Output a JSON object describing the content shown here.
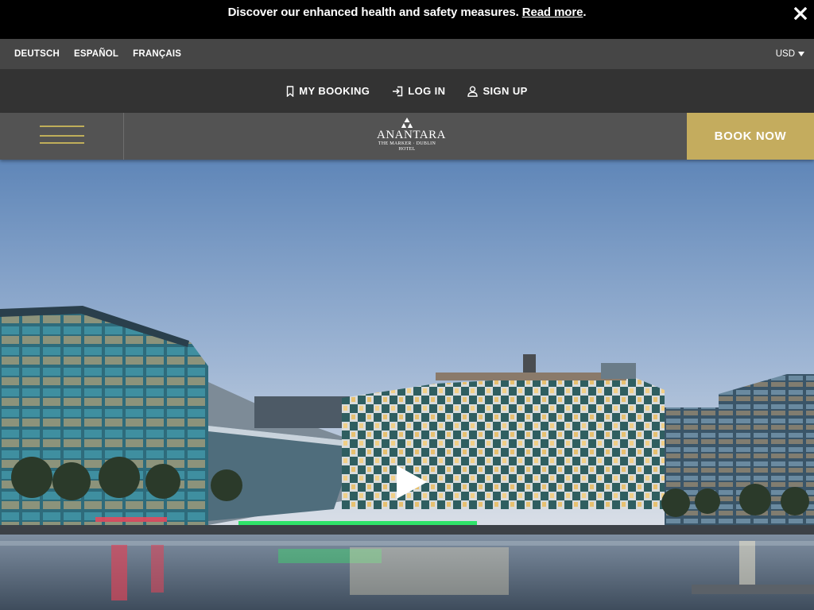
{
  "announcement": {
    "message": "Discover our enhanced health and safety measures.",
    "link_text": "Read more",
    "trailing": ".",
    "close_icon": "close-icon"
  },
  "languages": [
    "DEUTSCH",
    "ESPAÑOL",
    "FRANÇAIS"
  ],
  "currency": {
    "label": "USD",
    "icon": "caret-down-icon"
  },
  "account": {
    "my_booking": "MY BOOKING",
    "log_in": "LOG IN",
    "sign_up": "SIGN UP"
  },
  "nav": {
    "menu_icon": "hamburger-menu-icon",
    "logo_name": "ANANTARA",
    "logo_sub1": "THE MARKER · DUBLIN",
    "logo_sub2": "HOTEL",
    "book_now": "BOOK NOW"
  },
  "hero": {
    "play_icon": "play-icon"
  },
  "colors": {
    "announce_bg": "#000000",
    "langbar_bg": "#464646",
    "acctbar_bg": "#333333",
    "nav_bg": "#535353",
    "accent_gold": "#c4ac5e"
  }
}
